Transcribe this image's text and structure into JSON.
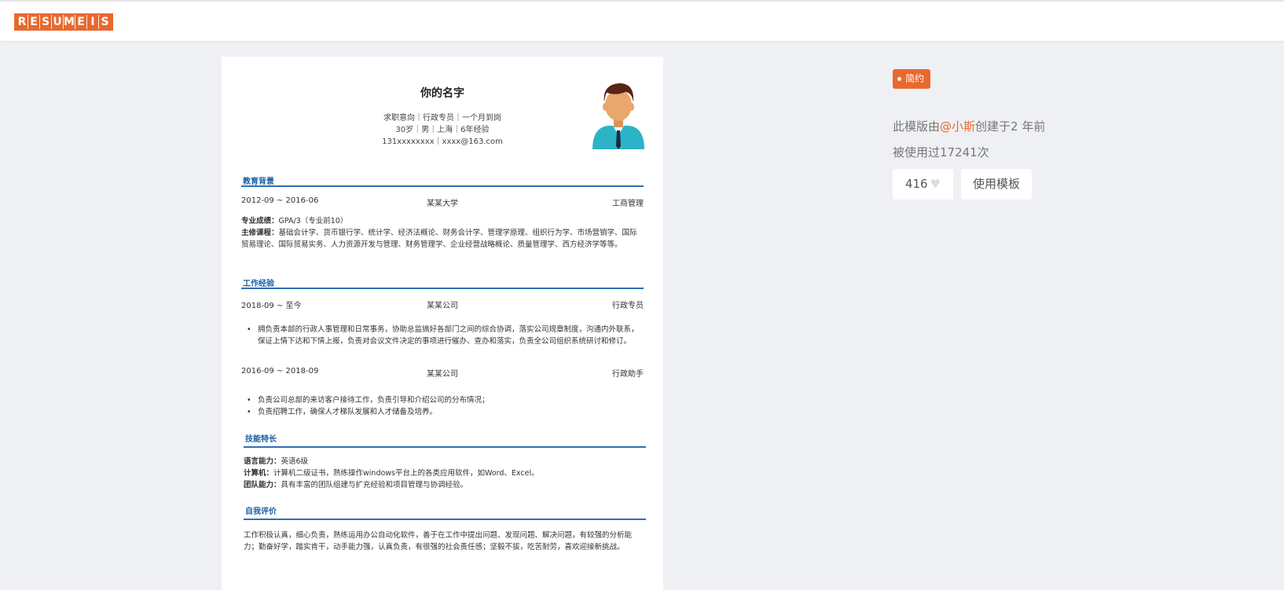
{
  "header": {
    "logo_letters": [
      "R",
      "E",
      "S",
      "U",
      "M",
      "E",
      "I",
      "S"
    ]
  },
  "resume": {
    "name": "你的名字",
    "info_line1": "求职意向｜行政专员｜一个月到岗",
    "info_line2": "30岁｜男｜上海｜6年经验",
    "info_line3": "131xxxxxxxx｜xxxx@163.com",
    "education": {
      "title": "教育背景",
      "date": "2012-09 ~ 2016-06",
      "school": "某某大学",
      "major": "工商管理",
      "score_label": "专业成绩：",
      "score_value": "GPA/3（专业前10）",
      "courses_label": "主修课程：",
      "courses_value": "基础会计学、货币银行学、统计学、经济法概论、财务会计学、管理学原理、组织行为学、市场营销学、国际贸易理论、国际贸易实务、人力资源开发与管理、财务管理学、企业经营战略概论、质量管理学、西方经济学等等。"
    },
    "work": {
      "title": "工作经验",
      "jobs": [
        {
          "date": "2018-09 ~ 至今",
          "company": "某某公司",
          "position": "行政专员",
          "bullets": [
            "拥负责本部的行政人事管理和日常事务，协助总监搞好各部门之间的综合协调，落实公司规章制度，沟通内外联系，保证上情下达和下情上报，负责对会议文件决定的事项进行催办、查办和落实，负责全公司组织系统研讨和修订。"
          ]
        },
        {
          "date": "2016-09 ~ 2018-09",
          "company": "某某公司",
          "position": "行政助手",
          "bullets": [
            "负责公司总部的来访客户接待工作，负责引导和介绍公司的分布情况；",
            "负责招聘工作，确保人才梯队发展和人才储备及培养。"
          ]
        }
      ]
    },
    "skills": {
      "title": "技能特长",
      "items": [
        {
          "label": "语言能力：",
          "value": "英语6级"
        },
        {
          "label": "计算机：",
          "value": "计算机二级证书，熟练操作windows平台上的各类应用软件，如Word、Excel。"
        },
        {
          "label": "团队能力：",
          "value": "具有丰富的团队组建与扩充经验和项目管理与协调经验。"
        }
      ]
    },
    "self": {
      "title": "自我评价",
      "text": "工作积极认真，细心负责，熟练运用办公自动化软件，善于在工作中提出问题、发现问题、解决问题，有较强的分析能力；勤奋好学，踏实肯干，动手能力强，认真负责，有很强的社会责任感；坚毅不拔，吃苦耐劳，喜欢迎接新挑战。"
    }
  },
  "sidebar": {
    "tag": "简约",
    "created_prefix": "此模版由",
    "author": "@小斯",
    "created_suffix": "创建于2 年前",
    "used": "被使用过17241次",
    "likes": "416",
    "use_button": "使用模板"
  }
}
